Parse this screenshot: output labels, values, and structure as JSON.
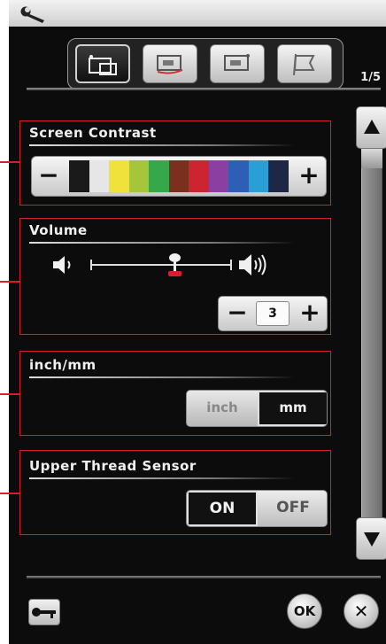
{
  "header": {
    "icon": "wrench-icon"
  },
  "tabs": [
    {
      "icon": "machine-settings-icon",
      "active": true
    },
    {
      "icon": "embroidery-settings-icon",
      "active": false
    },
    {
      "icon": "display-settings-icon",
      "active": false
    },
    {
      "icon": "language-flag-icon",
      "active": false
    }
  ],
  "page": {
    "indicator": "1/5"
  },
  "screen_contrast": {
    "title": "Screen Contrast",
    "minus": "−",
    "plus": "+",
    "swatch_colors": [
      "#1a1a1a",
      "#e6e6e6",
      "#f0e23a",
      "#a7c53a",
      "#36a84b",
      "#79301f",
      "#cc2430",
      "#8b3fa0",
      "#2d5fb4",
      "#2a9fd6",
      "#1e2846"
    ]
  },
  "volume": {
    "title": "Volume",
    "level": 3,
    "level_min": 1,
    "level_max": 5,
    "minus": "−",
    "plus": "+",
    "value": "3",
    "icons": [
      "speaker-low-icon",
      "speaker-high-icon"
    ]
  },
  "units": {
    "title": "inch/mm",
    "options": [
      "inch",
      "mm"
    ],
    "selected": "mm"
  },
  "upper_thread_sensor": {
    "title": "Upper Thread Sensor",
    "on": "ON",
    "off": "OFF",
    "selected": "ON"
  },
  "footer": {
    "ok": "OK",
    "close": "✕",
    "key_icon": "key-icon"
  },
  "colors": {
    "accent_red": "#d71f2b",
    "background": "#0c0c0c"
  }
}
